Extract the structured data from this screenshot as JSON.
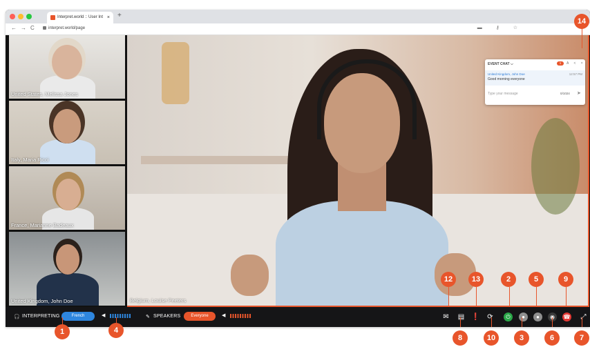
{
  "browser": {
    "tab_title": "Interpret.world :: User Interfac",
    "tab_close": "×",
    "new_tab": "+",
    "url": "interpret.world/page",
    "nav_back": "←",
    "nav_forward": "→",
    "nav_reload": "C",
    "url_icons": "▬ ⚷ ☆"
  },
  "participants": [
    {
      "label": "United States, Melissa Jones"
    },
    {
      "label": "Italy, Maria Ricci"
    },
    {
      "label": "France, Marianne Badeaux"
    },
    {
      "label": "United Kingdom, John Doe"
    }
  ],
  "main_video": {
    "label": "Belgium, Louise Peeters"
  },
  "chat": {
    "title": "EVENT CHAT ⌵",
    "unread": "1",
    "controls": "A͏ < ×",
    "sender": "United Kingdom, John Doe",
    "time": "12:57 PM",
    "message": "Good morning everyone",
    "placeholder": "Type your message",
    "counter": "0/1024",
    "send_icon": "➤"
  },
  "toolbar": {
    "interpreting_label": "INTERPRETING",
    "language": "French",
    "speakers_label": "SPEAKERS",
    "speakers_value": "Everyone",
    "headphones_icon": "🎧",
    "mic_off_icon": "✎",
    "speaker_icon": "◀",
    "mail_icon": "✉",
    "chat_icon": "▤",
    "alert_icon": "❗",
    "refresh_icon": "⟳",
    "power_icon": "⏻",
    "mic_icon": "●",
    "camera_icon": "●",
    "caption_icon": "◉",
    "hangup_icon": "☎",
    "expand_icon": "⤢"
  },
  "callouts": [
    "1",
    "2",
    "3",
    "4",
    "5",
    "6",
    "7",
    "8",
    "9",
    "10",
    "12",
    "13",
    "14"
  ],
  "colors": {
    "accent": "#e8552b",
    "interpreting_pill": "#2e86de",
    "speakers_pill": "#e8552b",
    "volume_blue": "#2e86de",
    "volume_red": "#e8552b",
    "power_green": "#2aa748",
    "hangup_red": "#e53935"
  }
}
